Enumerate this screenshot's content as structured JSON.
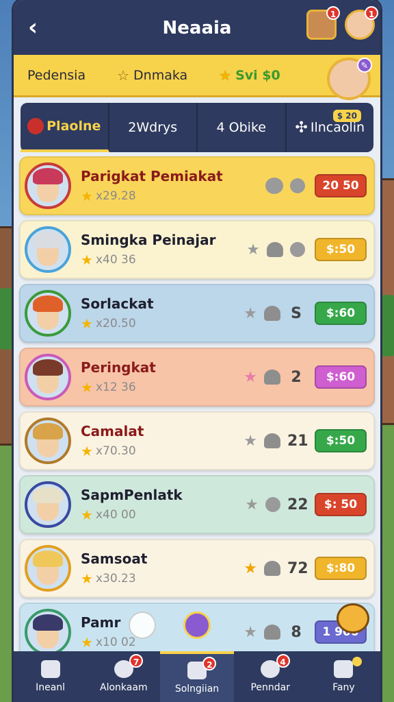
{
  "header": {
    "title": "Neaaia",
    "notifications": [
      "1",
      "1"
    ]
  },
  "infobar": {
    "label": "Pedensia",
    "star_label": "Dnmaka",
    "currency": "Svi $0"
  },
  "tabs": [
    {
      "label": "Plaolne",
      "active": true
    },
    {
      "label": "2Wdrys",
      "active": false
    },
    {
      "label": "4 Obike",
      "active": false
    },
    {
      "label": "Ilncaolin",
      "active": false,
      "badge": "$ 20"
    }
  ],
  "rows": [
    {
      "name": "Parigkat Pemiakat",
      "stat": "x29.28",
      "num": "",
      "pill": "20 50",
      "bg": "#f9d65a",
      "border": "#c93a3a",
      "pill_color": "#d9452b",
      "mid_type": "circles",
      "hair": "#c93a5a"
    },
    {
      "name": "Smingka Peinajar",
      "stat": "x40 36",
      "num": "",
      "pill": "$:50",
      "bg": "#fbf3d0",
      "border": "#4aa3d9",
      "pill_color": "#f0b52a",
      "mid_type": "circle",
      "hair": "#d9dde2"
    },
    {
      "name": "Sorlackat",
      "stat": "x20.50",
      "num": "S",
      "pill": "$:60",
      "bg": "#bcd6ea",
      "border": "#3a9a3a",
      "pill_color": "#36a84a",
      "mid_type": "num",
      "hair": "#e0602a"
    },
    {
      "name": "Peringkat",
      "stat": "x12 36",
      "num": "2",
      "pill": "$:60",
      "bg": "#f7c4a8",
      "border": "#c95ab9",
      "pill_color": "#cf5ed0",
      "mid_type": "num",
      "hair": "#7a3a2a"
    },
    {
      "name": "Camalat",
      "stat": "x70.30",
      "num": "21",
      "pill": "$:50",
      "bg": "#fbf3e2",
      "border": "#b07a2a",
      "pill_color": "#36a84a",
      "mid_type": "num",
      "hair": "#d9a34a"
    },
    {
      "name": "SapmPenlatk",
      "stat": "x40 00",
      "num": "22",
      "pill": "$: 50",
      "bg": "#cfe8dc",
      "border": "#3a4aa0",
      "pill_color": "#d9452b",
      "mid_type": "num",
      "hair": "#e6e0c8"
    },
    {
      "name": "Samsoat",
      "stat": "x30.23",
      "num": "72",
      "pill": "$:80",
      "bg": "#fbf3e2",
      "border": "#e0a020",
      "pill_color": "#f0b52a",
      "mid_type": "num",
      "hair": "#f0c85a"
    },
    {
      "name": "Pamr",
      "stat": "x10 02",
      "num": "8",
      "pill": "1 900",
      "bg": "#c9e4f0",
      "border": "#3a9a6a",
      "pill_color": "#6a6ad0",
      "mid_type": "num",
      "hair": "#3a3a6a"
    }
  ],
  "nav": [
    {
      "label": "Ineanl",
      "badge": "",
      "active": false
    },
    {
      "label": "Alonkaam",
      "badge": "7",
      "active": false
    },
    {
      "label": "Solngiian",
      "badge": "2",
      "active": true
    },
    {
      "label": "Penndar",
      "badge": "4",
      "active": false
    },
    {
      "label": "Fany",
      "badge": "",
      "active": false
    }
  ]
}
